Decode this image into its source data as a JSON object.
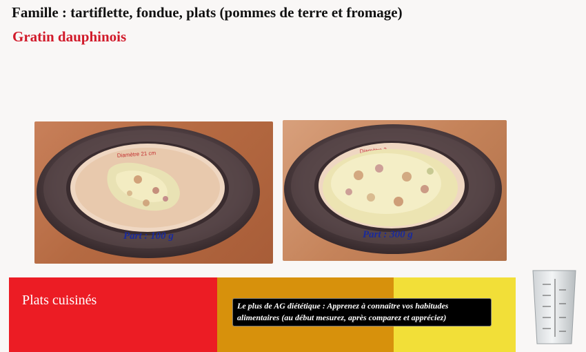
{
  "header": {
    "family": "Famille : tartiflette, fondue, plats (pommes de terre et fromage)",
    "dish": "Gratin dauphinois"
  },
  "portions": [
    {
      "label": "Part : 100 g",
      "grams": 100
    },
    {
      "label": "Part : 300 g",
      "grams": 300
    }
  ],
  "plate_caption": "Diamètre 21 cm",
  "footer": {
    "category": "Plats cuisinés",
    "tip": "Le plus de AG diététique : Apprenez à connaître vos habitudes alimentaires (au début mesurez, après comparez et appréciez)"
  },
  "colors": {
    "dish_title": "#d11a2a",
    "portion_label": "#1a2a9a",
    "band_red": "#ec1c24",
    "band_orange": "#d7910c",
    "band_yellow": "#f2df38"
  },
  "icons": [
    "plate-photo",
    "measuring-cup-icon"
  ]
}
